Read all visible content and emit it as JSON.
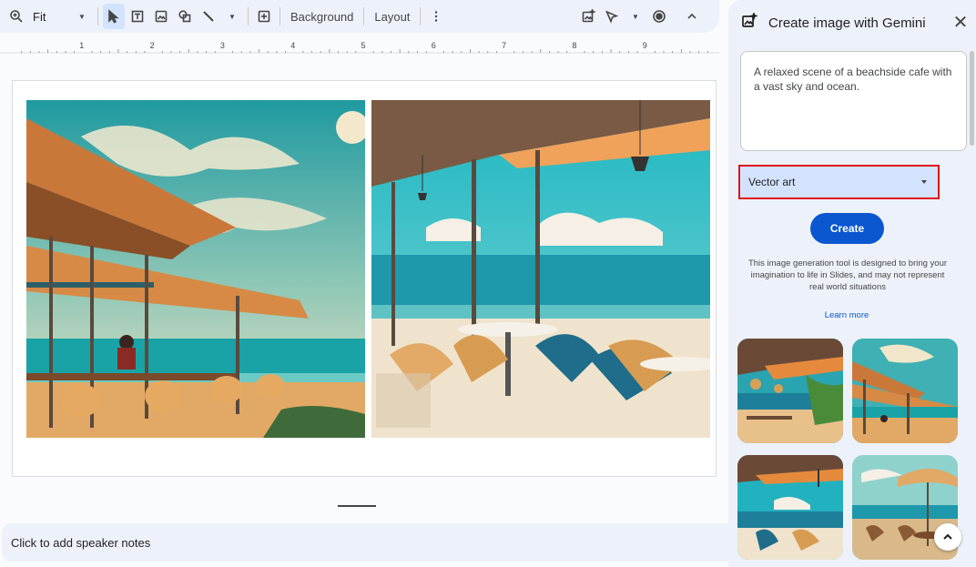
{
  "toolbar": {
    "zoom_label": "Fit",
    "background_label": "Background",
    "layout_label": "Layout"
  },
  "ruler": {
    "numbers": [
      "1",
      "2",
      "3",
      "4",
      "5",
      "6",
      "7",
      "8",
      "9"
    ]
  },
  "notes": {
    "placeholder": "Click to add speaker notes"
  },
  "panel": {
    "title": "Create image with Gemini",
    "prompt_text": "A relaxed scene of a beachside cafe with a vast sky and ocean.",
    "style_value": "Vector art",
    "create_label": "Create",
    "disclaimer": "This image generation tool is designed to bring your imagination to life in Slides, and may not represent real world situations",
    "learn_more": "Learn more"
  },
  "colors": {
    "accent": "#0b57d0",
    "highlight_border": "#e0101b",
    "panel_bg": "#edf2fa"
  }
}
